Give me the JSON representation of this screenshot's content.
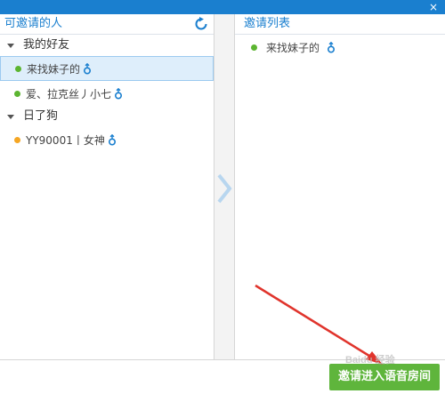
{
  "window": {
    "close_glyph": "×"
  },
  "left_panel": {
    "title": "可邀请的人",
    "refresh_icon": "refresh-icon",
    "groups": [
      {
        "name": "我的好友",
        "contacts": [
          {
            "name": "来找妹子的",
            "status_color": "#5cb531",
            "gender_icon": "male-icon",
            "selected": true
          },
          {
            "name": "爱、拉克丝丿小七",
            "status_color": "#5cb531",
            "gender_icon": "male-icon",
            "selected": false
          }
        ]
      },
      {
        "name": "日了狗",
        "contacts": [
          {
            "name": "YY90001丨女神",
            "status_color": "#f5a623",
            "gender_icon": "male-icon",
            "selected": false
          }
        ]
      }
    ]
  },
  "transfer": {
    "icon": "chevron-right-icon"
  },
  "right_panel": {
    "title": "邀请列表",
    "contacts": [
      {
        "name": "来找妹子的",
        "status_color": "#5cb531",
        "gender_icon": "male-icon"
      }
    ]
  },
  "footer": {
    "invite_button_label": "邀请进入语音房间"
  },
  "watermark": {
    "text": "Baidu 经验"
  },
  "colors": {
    "accent": "#1a7fcf",
    "button_green": "#5fb53c",
    "annotation_red": "#e0342c"
  }
}
